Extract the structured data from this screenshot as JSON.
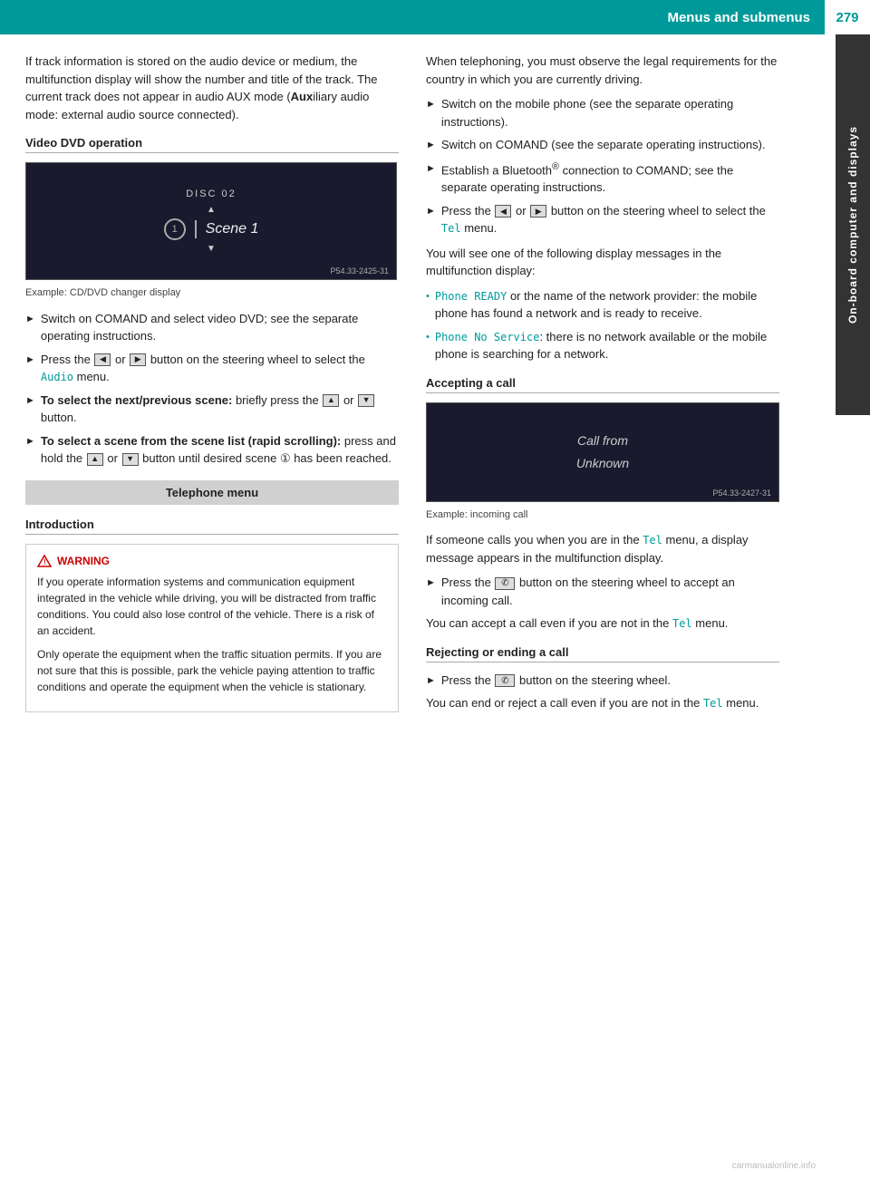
{
  "header": {
    "title": "Menus and submenus",
    "page": "279"
  },
  "sidebar": {
    "label": "On-board computer and displays"
  },
  "left_column": {
    "intro_paragraph": "If track information is stored on the audio device or medium, the multifunction display will show the number and title of the track. The current track does not appear in audio AUX mode (",
    "intro_aux": "Aux",
    "intro_paragraph2": "iliary audio mode: external audio source connected).",
    "dvd_section": {
      "heading": "Video DVD operation",
      "dvd_disc_label": "DISC 02",
      "dvd_scene_label": "Scene 1",
      "dvd_ref": "P54.33-2425-31",
      "caption": "Example: CD/DVD changer display",
      "bullets": [
        {
          "text": "Switch on COMAND and select video DVD; see the separate operating instructions."
        },
        {
          "text": "Press the",
          "button1": "◄",
          "mid": " or ",
          "button2": "►",
          "end_text": " button on the steering wheel to select the ",
          "term": "Audio",
          "term_class": "audio",
          "end2": " menu."
        },
        {
          "bold_start": "To select the next/previous scene:",
          "text": " briefly press the",
          "button1": "▲",
          "mid": " or ",
          "button2": "▼",
          "end_text": " button."
        },
        {
          "bold_start": "To select a scene from the scene list (rapid scrolling):",
          "text": " press and hold the",
          "button1": "▲",
          "mid": " or ",
          "button2": "▼",
          "end_text": " button until desired scene",
          "circle_num": "①",
          "end2": " has been reached."
        }
      ]
    },
    "tel_menu": {
      "label": "Telephone menu"
    },
    "introduction": {
      "heading": "Introduction",
      "warning_title": "WARNING",
      "warning_para1": "If you operate information systems and communication equipment integrated in the vehicle while driving, you will be distracted from traffic conditions. You could also lose control of the vehicle. There is a risk of an accident.",
      "warning_para2": "Only operate the equipment when the traffic situation permits. If you are not sure that this is possible, park the vehicle paying attention to traffic conditions and operate the equipment when the vehicle is stationary."
    }
  },
  "right_column": {
    "intro_paragraph": "When telephoning, you must observe the legal requirements for the country in which you are currently driving.",
    "bullets": [
      {
        "text": "Switch on the mobile phone (see the separate operating instructions)."
      },
      {
        "text": "Switch on COMAND (see the separate operating instructions)."
      },
      {
        "text": "Establish a Bluetooth® connection to COMAND; see the separate operating instructions."
      },
      {
        "text": "Press the",
        "button1": "◄",
        "mid": " or ",
        "button2": "►",
        "end_text": " button on the steering wheel to select the ",
        "term": "Tel",
        "term_class": "tel",
        "end2": " menu."
      }
    ],
    "display_messages_intro": "You will see one of the following display messages in the multifunction display:",
    "dot_bullets": [
      {
        "term": "Phone READY",
        "term_class": "tel",
        "text": " or the name of the network provider: the mobile phone has found a network and is ready to receive."
      },
      {
        "term": "Phone No Service",
        "term_class": "tel",
        "text": ": there is no network available or the mobile phone is searching for a network."
      }
    ],
    "accepting_section": {
      "heading": "Accepting a call",
      "call_inner_line1": "Call from",
      "call_inner_line2": "Unknown",
      "call_ref": "P54.33-2427-31",
      "caption": "Example: incoming call",
      "para1_start": "If someone calls you when you are in the ",
      "para1_term": "Tel",
      "para1_end": " menu, a display message appears in the multifunction display.",
      "bullet": {
        "text": "Press the",
        "button": "☎",
        "end_text": " button on the steering wheel to accept an incoming call."
      },
      "para2_start": "You can accept a call even if you are not in the ",
      "para2_term": "Tel",
      "para2_end": " menu."
    },
    "rejecting_section": {
      "heading": "Rejecting or ending a call",
      "bullet": {
        "text": "Press the",
        "button": "☎",
        "end_text": " button on the steering wheel."
      },
      "para_start": "You can end or reject a call even if you are not in the ",
      "para_term": "Tel",
      "para_end": " menu."
    }
  },
  "watermark": "carmanualonline.info"
}
